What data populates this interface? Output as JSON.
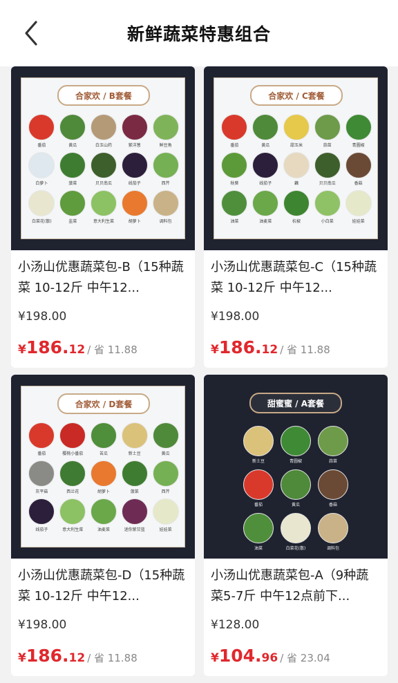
{
  "header": {
    "title": "新鲜蔬菜特惠组合",
    "back_icon": "chevron-left-icon"
  },
  "colors": {
    "price": "#e0282d",
    "thumb_bg": "#1f2330",
    "banner_border": "#c8a987"
  },
  "products": [
    {
      "banner": "合家欢 / B套餐",
      "name": "小汤山优惠蔬菜包-B（15种蔬菜 10-12斤 中午12...",
      "original_price": "¥198.00",
      "price_yen": "¥",
      "price_int": "186.",
      "price_dec": "12",
      "save": "/ 省 11.88",
      "vegetables": [
        {
          "label": "番茄",
          "color": "#d9392b"
        },
        {
          "label": "黄瓜",
          "color": "#4e8a3a"
        },
        {
          "label": "白玉山药",
          "color": "#b59a78"
        },
        {
          "label": "紫洋葱",
          "color": "#7b2a44"
        },
        {
          "label": "鲜豆角",
          "color": "#7fb35a"
        },
        {
          "label": "白萝卜",
          "color": "#dfe8ee"
        },
        {
          "label": "菠菜",
          "color": "#3e7d31"
        },
        {
          "label": "贝贝南瓜",
          "color": "#3d5f2c"
        },
        {
          "label": "线茄子",
          "color": "#2c1f3b"
        },
        {
          "label": "西芹",
          "color": "#75b054"
        },
        {
          "label": "白菜花(散)",
          "color": "#e9e6cf"
        },
        {
          "label": "韭菜",
          "color": "#5e9c3e"
        },
        {
          "label": "意大利生菜",
          "color": "#8cc263"
        },
        {
          "label": "胡萝卜",
          "color": "#e9792e"
        },
        {
          "label": "调料包",
          "color": "#c9b288"
        }
      ]
    },
    {
      "banner": "合家欢 / C套餐",
      "name": "小汤山优惠蔬菜包-C（15种蔬菜 10-12斤 中午12...",
      "original_price": "¥198.00",
      "price_yen": "¥",
      "price_int": "186.",
      "price_dec": "12",
      "save": "/ 省 11.88",
      "vegetables": [
        {
          "label": "番茄",
          "color": "#d9392b"
        },
        {
          "label": "黄瓜",
          "color": "#4e8a3a"
        },
        {
          "label": "甜玉米",
          "color": "#e6c84a"
        },
        {
          "label": "蒜苗",
          "color": "#6e9b4a"
        },
        {
          "label": "青圆椒",
          "color": "#3f8a35"
        },
        {
          "label": "秋葵",
          "color": "#5c9a39"
        },
        {
          "label": "线茄子",
          "color": "#2c1f3b"
        },
        {
          "label": "藕",
          "color": "#e6d9bf"
        },
        {
          "label": "贝贝南瓜",
          "color": "#3d5f2c"
        },
        {
          "label": "香菇",
          "color": "#6b4a35"
        },
        {
          "label": "油菜",
          "color": "#4f8f3c"
        },
        {
          "label": "油麦菜",
          "color": "#6aa84a"
        },
        {
          "label": "杭椒",
          "color": "#3e8531"
        },
        {
          "label": "小白菜",
          "color": "#8fc266"
        },
        {
          "label": "娃娃菜",
          "color": "#e6e9c9"
        }
      ]
    },
    {
      "banner": "合家欢 / D套餐",
      "name": "小汤山优惠蔬菜包-D（15种蔬菜 10-12斤 中午12...",
      "original_price": "¥198.00",
      "price_yen": "¥",
      "price_int": "186.",
      "price_dec": "12",
      "save": "/ 省 11.88",
      "vegetables": [
        {
          "label": "番茄",
          "color": "#d9392b"
        },
        {
          "label": "樱桃小番茄",
          "color": "#c92a25"
        },
        {
          "label": "苦瓜",
          "color": "#4f8e3a"
        },
        {
          "label": "新土豆",
          "color": "#dbc27a"
        },
        {
          "label": "黄瓜",
          "color": "#4e8a3a"
        },
        {
          "label": "灰平菇",
          "color": "#8a8a86"
        },
        {
          "label": "西兰花",
          "color": "#3f7b32"
        },
        {
          "label": "胡萝卜",
          "color": "#e9792e"
        },
        {
          "label": "菠菜",
          "color": "#3e7d31"
        },
        {
          "label": "西芹",
          "color": "#75b054"
        },
        {
          "label": "线茄子",
          "color": "#2c1f3b"
        },
        {
          "label": "意大利生菜",
          "color": "#8cc263"
        },
        {
          "label": "油麦菜",
          "color": "#6aa84a"
        },
        {
          "label": "迷你紫甘蓝",
          "color": "#6e2c55"
        },
        {
          "label": "娃娃菜",
          "color": "#e6e9c9"
        }
      ]
    },
    {
      "banner": "甜蜜蜜 / A套餐",
      "name": "小汤山优惠蔬菜包-A（9种蔬菜5-7斤 中午12点前下...",
      "original_price": "¥128.00",
      "price_yen": "¥",
      "price_int": "104.",
      "price_dec": "96",
      "save": "/ 省 23.04",
      "dark": true,
      "vegetables": [
        {
          "label": "新土豆",
          "color": "#dbc27a"
        },
        {
          "label": "青圆椒",
          "color": "#3f8a35"
        },
        {
          "label": "蒜苗",
          "color": "#6e9b4a"
        },
        {
          "label": "番茄",
          "color": "#d9392b"
        },
        {
          "label": "黄瓜",
          "color": "#4e8a3a"
        },
        {
          "label": "香菇",
          "color": "#6b4a35"
        },
        {
          "label": "油菜",
          "color": "#4f8f3c"
        },
        {
          "label": "白菜花(散)",
          "color": "#e9e6cf"
        },
        {
          "label": "调料包",
          "color": "#c9b288"
        }
      ]
    }
  ]
}
